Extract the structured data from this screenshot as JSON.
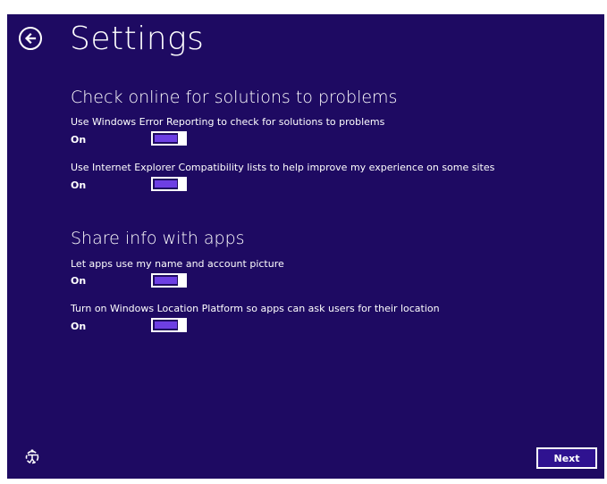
{
  "header": {
    "title": "Settings"
  },
  "sections": [
    {
      "heading": "Check online for solutions to problems",
      "settings": [
        {
          "label": "Use Windows Error Reporting to check for solutions to problems",
          "state": "On"
        },
        {
          "label": "Use Internet Explorer Compatibility lists to help improve my experience on some sites",
          "state": "On"
        }
      ]
    },
    {
      "heading": "Share info with apps",
      "settings": [
        {
          "label": "Let apps use my name and account picture",
          "state": "On"
        },
        {
          "label": "Turn on Windows Location Platform so apps can ask users for their location",
          "state": "On"
        }
      ]
    }
  ],
  "footer": {
    "next_label": "Next"
  },
  "icons": {
    "back": "arrow-left-circle-icon",
    "ease_of_access": "ease-of-access-icon"
  },
  "colors": {
    "background": "#1e0a62",
    "toggle_fill": "#6d3fe3",
    "foreground": "#ffffff"
  }
}
